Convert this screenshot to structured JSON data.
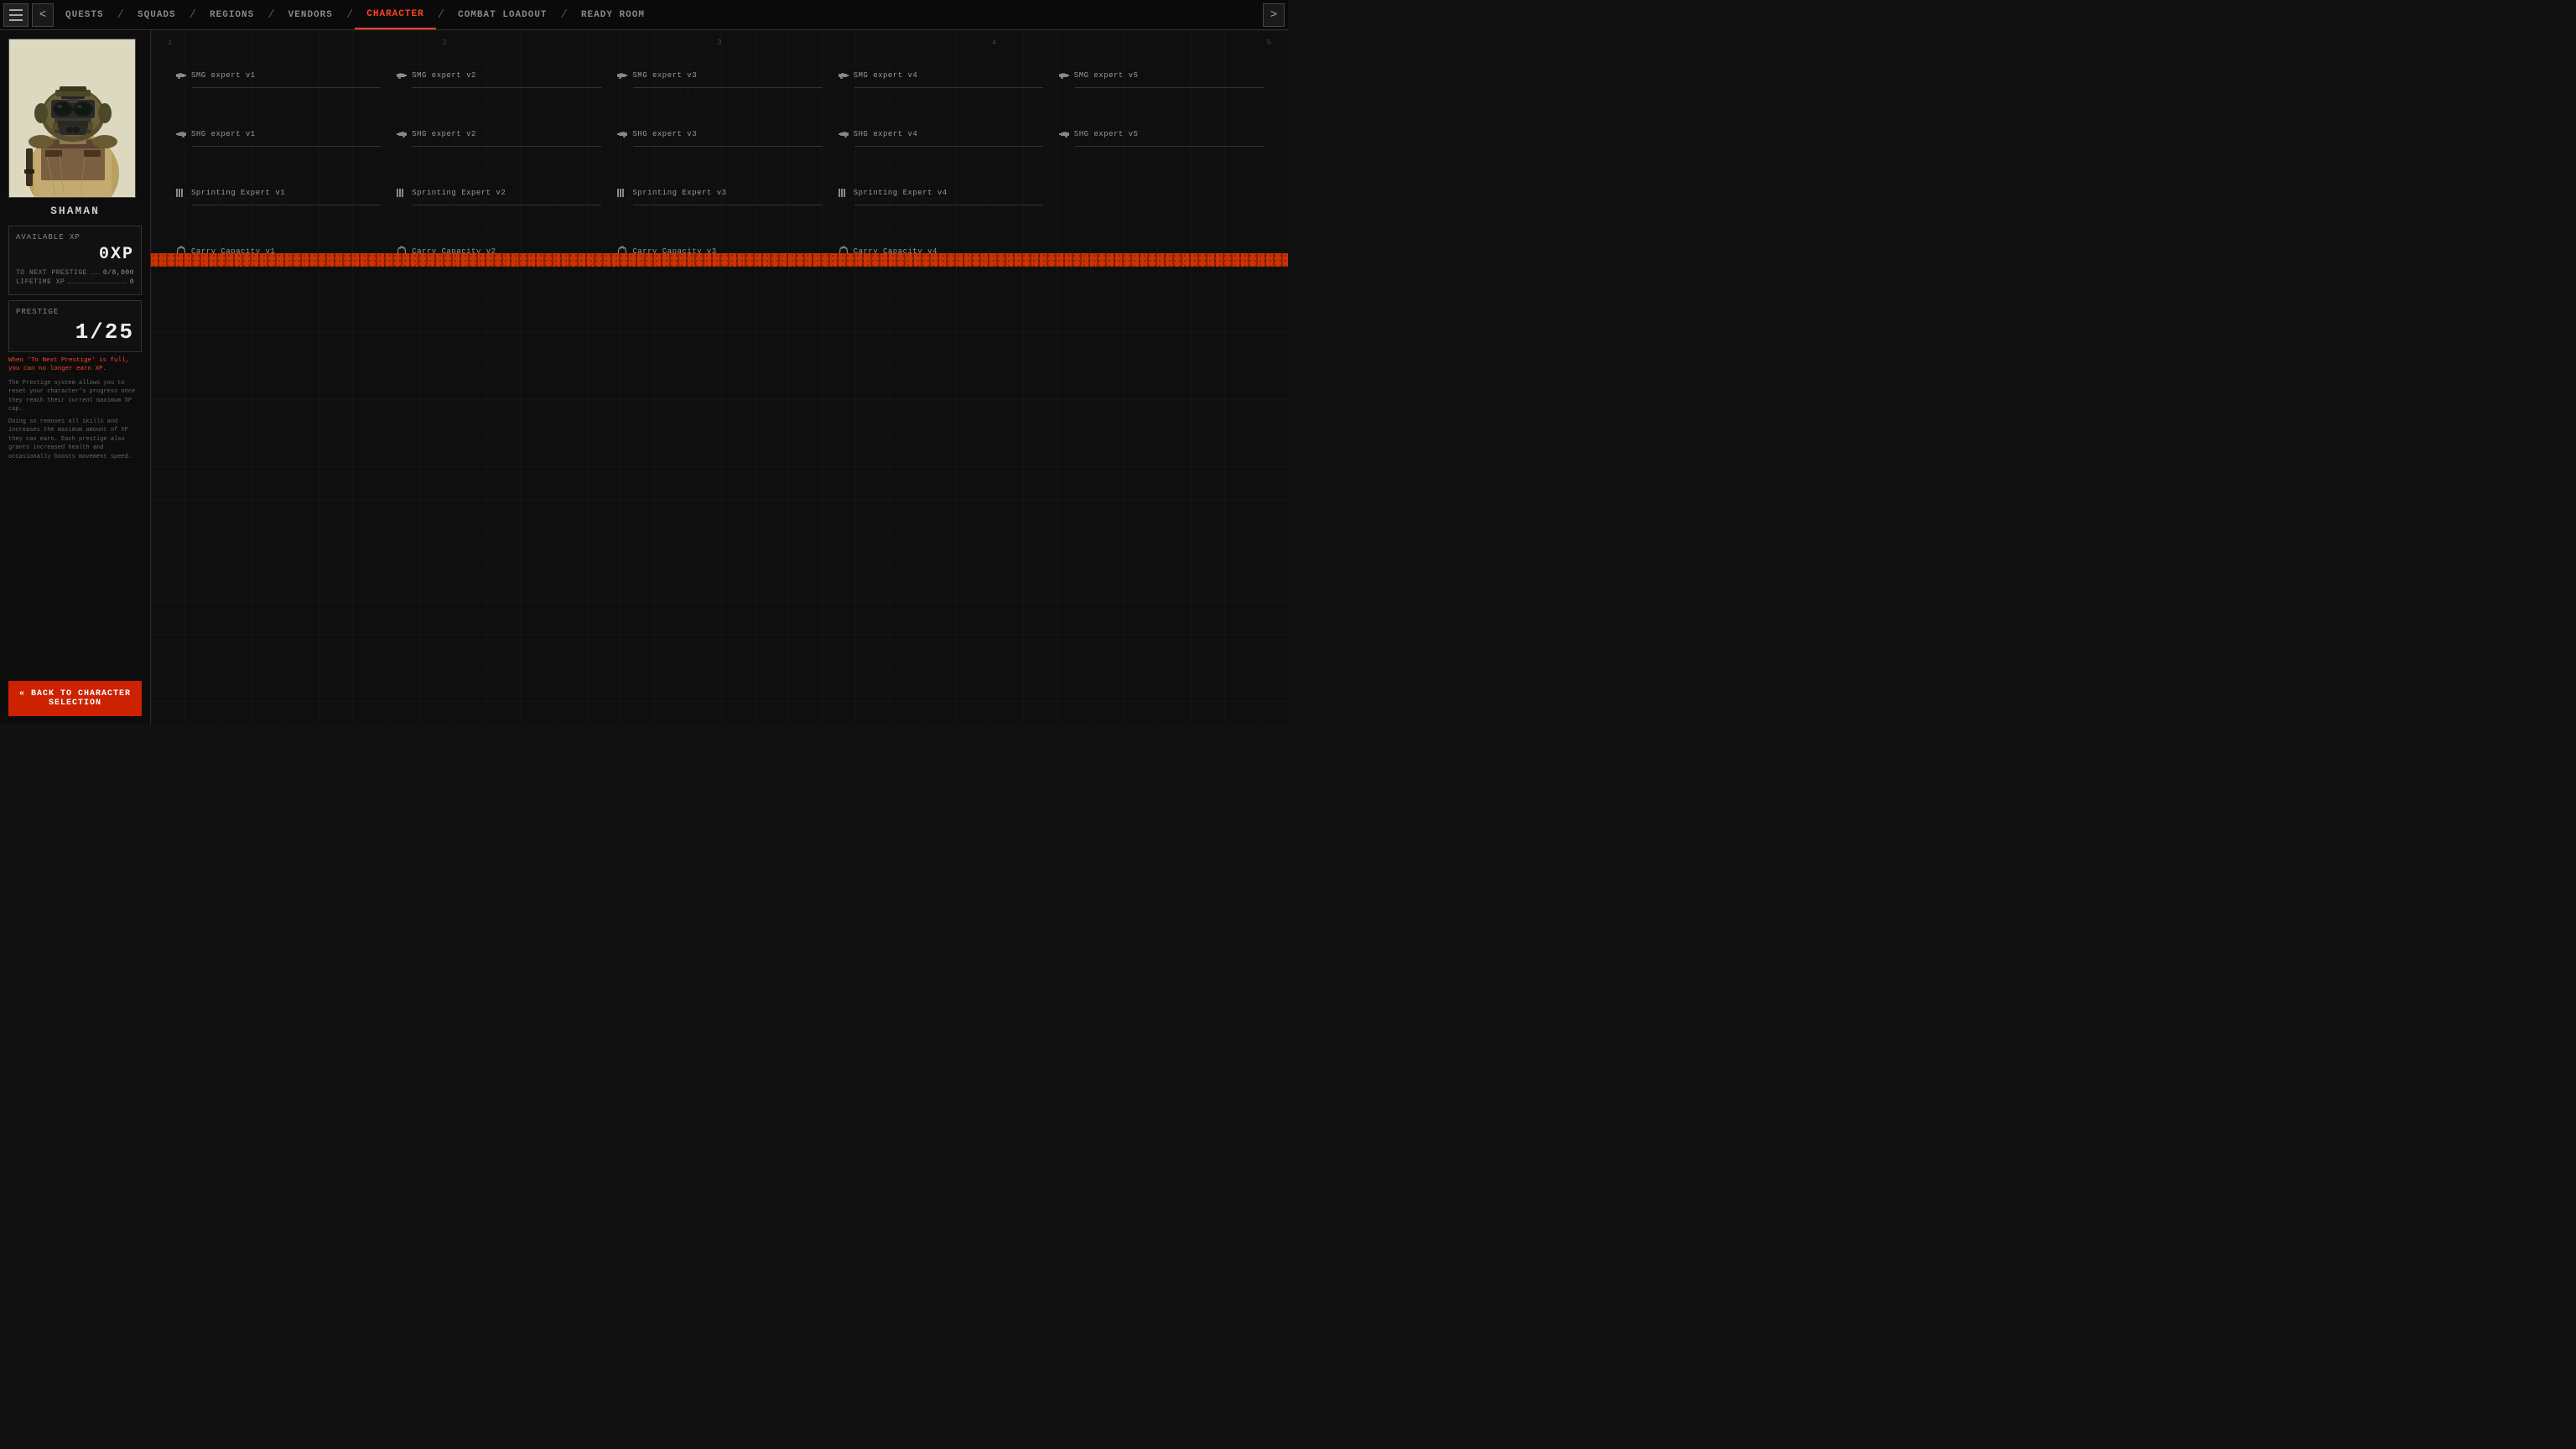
{
  "nav": {
    "items": [
      {
        "label": "QUESTS",
        "active": false
      },
      {
        "label": "SQUADS",
        "active": false
      },
      {
        "label": "REGIONS",
        "active": false
      },
      {
        "label": "VENDORS",
        "active": false
      },
      {
        "label": "CHARACTER",
        "active": true
      },
      {
        "label": "COMBAT LOADOUT",
        "active": false
      },
      {
        "label": "READY ROOM",
        "active": false
      }
    ]
  },
  "character": {
    "name": "SHAMAN"
  },
  "xp": {
    "label": "AVAILABLE XP",
    "value": "0XP",
    "to_next_prestige_label": "TO NEXT PRESTIGE",
    "to_next_prestige_value": "0/8,000",
    "lifetime_xp_label": "LIFETIME XP",
    "lifetime_xp_value": "0"
  },
  "prestige": {
    "label": "PRESTIGE",
    "value": "1/25",
    "warning": "When 'To Next Prestige' is full, you can no longer earn XP.",
    "desc1": "The Prestige system allows you to reset your character's progress once they reach their current maximum XP cap.",
    "desc2": "Doing so removes all skills and increases the maximum amount of XP they can earn. Each prestige also grants increased health and occasionally boosts movement speed."
  },
  "back_button": {
    "label": "« BACK TO CHARACTER SELECTION"
  },
  "progress_indicators": {
    "p1": "1",
    "p2": "2",
    "p3": "3",
    "p4": "4",
    "p5": "5"
  },
  "skills": {
    "smg_row": [
      {
        "name": "SMG expert v1",
        "icon": "smg"
      },
      {
        "name": "SMG expert v2",
        "icon": "smg"
      },
      {
        "name": "SMG expert v3",
        "icon": "smg"
      },
      {
        "name": "SMG expert v4",
        "icon": "smg"
      },
      {
        "name": "SMG expert v5",
        "icon": "smg"
      }
    ],
    "shg_row": [
      {
        "name": "SHG expert v1",
        "icon": "shg"
      },
      {
        "name": "SHG expert v2",
        "icon": "shg"
      },
      {
        "name": "SHG expert v3",
        "icon": "shg"
      },
      {
        "name": "SHG expert v4",
        "icon": "shg"
      },
      {
        "name": "SHG expert v5",
        "icon": "shg"
      }
    ],
    "sprint_row": [
      {
        "name": "Sprinting Expert v1",
        "icon": "sprint"
      },
      {
        "name": "Sprinting Expert v2",
        "icon": "sprint"
      },
      {
        "name": "Sprinting Expert v3",
        "icon": "sprint"
      },
      {
        "name": "Sprinting Expert v4",
        "icon": "sprint"
      }
    ],
    "carry_row": [
      {
        "name": "Carry Capacity v1",
        "icon": "carry"
      },
      {
        "name": "Carry Capacity v2",
        "icon": "carry"
      },
      {
        "name": "Carry Capacity v3",
        "icon": "carry"
      },
      {
        "name": "Carry Capacity v4",
        "icon": "carry"
      }
    ]
  },
  "colors": {
    "accent": "#ff4422",
    "bg_dark": "#0a0a0a",
    "progress_bar": "#cc3300"
  }
}
